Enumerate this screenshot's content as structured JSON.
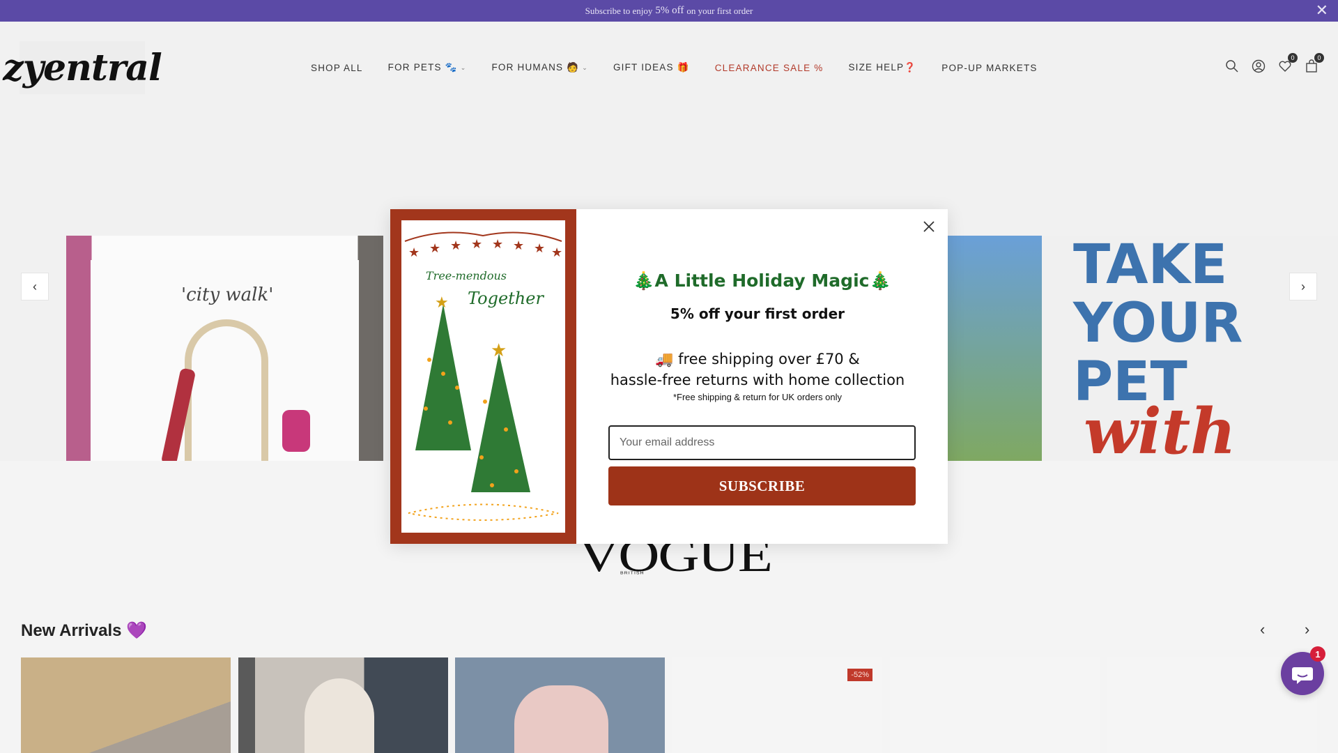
{
  "announcement": {
    "pre": "Subscribe to enjoy",
    "highlight": "5% off",
    "post": "on your first order",
    "close_icon": "close-icon"
  },
  "header": {
    "logo_text": "zyentral",
    "nav": [
      {
        "label": "SHOP ALL",
        "has_dropdown": false
      },
      {
        "label": "FOR PETS 🐾",
        "has_dropdown": true
      },
      {
        "label": "FOR HUMANS 🧑",
        "has_dropdown": true
      },
      {
        "label": "GIFT IDEAS 🎁",
        "has_dropdown": false
      },
      {
        "label": "CLEARANCE SALE %",
        "has_dropdown": false,
        "color": "#b23a2a"
      },
      {
        "label": "SIZE HELP❓",
        "has_dropdown": false
      },
      {
        "label": "POP-UP MARKETS",
        "has_dropdown": false
      }
    ],
    "icons": {
      "search": "search-icon",
      "account": "account-icon",
      "wishlist": "heart-icon",
      "wishlist_count": "0",
      "cart": "cart-icon",
      "cart_count": "0"
    }
  },
  "hero": {
    "left_slide_script": "'city walk'",
    "right_slide_lines": [
      "TAKE",
      "YOUR",
      "PET"
    ],
    "right_slide_script": "with"
  },
  "press": {
    "logo_text": "VOGUE",
    "logo_small": "BRITISH"
  },
  "popup": {
    "title": "🎄A Little Holiday Magic🎄",
    "subtitle": "5% off your first order",
    "shipping_line1": "🚚 free shipping over £70 &",
    "shipping_line2": "hassle-free returns with home collection",
    "note": "*Free shipping & return for UK orders only",
    "email_placeholder": "Your email address",
    "email_value": "",
    "button_label": "SUBSCRIBE",
    "art_text_1": "Tree-mendous",
    "art_text_2": "Together",
    "colors": {
      "title": "#1f6b2a",
      "button": "#9e3318",
      "art_border": "#a2361c"
    }
  },
  "new_arrivals": {
    "title": "New Arrivals 💜",
    "products": [
      {
        "discount": ""
      },
      {
        "discount": ""
      },
      {
        "discount": ""
      },
      {
        "discount": "-52%"
      },
      {
        "discount": ""
      },
      {
        "discount": ""
      }
    ]
  },
  "chat": {
    "icon": "chat-icon",
    "unread": "1"
  }
}
